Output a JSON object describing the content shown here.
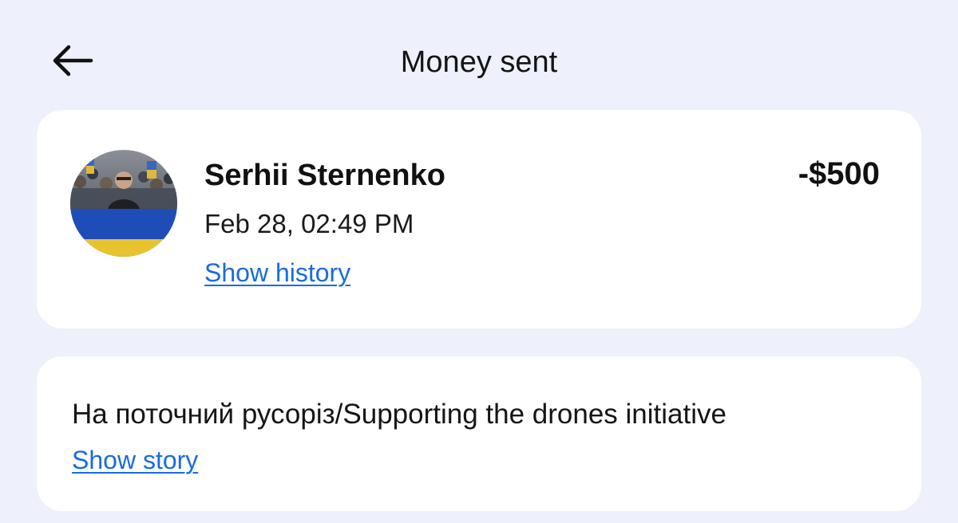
{
  "header": {
    "title": "Money sent",
    "back_icon": "arrow-left-icon"
  },
  "transaction": {
    "recipient_name": "Serhii Sternenko",
    "amount": "-$500",
    "timestamp": "Feb 28, 02:49 PM",
    "history_link": "Show history",
    "avatar": "profile-photo"
  },
  "story": {
    "text": "На поточний русоріз/Supporting the drones initiative",
    "link": "Show story"
  },
  "colors": {
    "background": "#eef0fb",
    "card": "#ffffff",
    "link": "#1a6be0",
    "text": "#111111"
  }
}
